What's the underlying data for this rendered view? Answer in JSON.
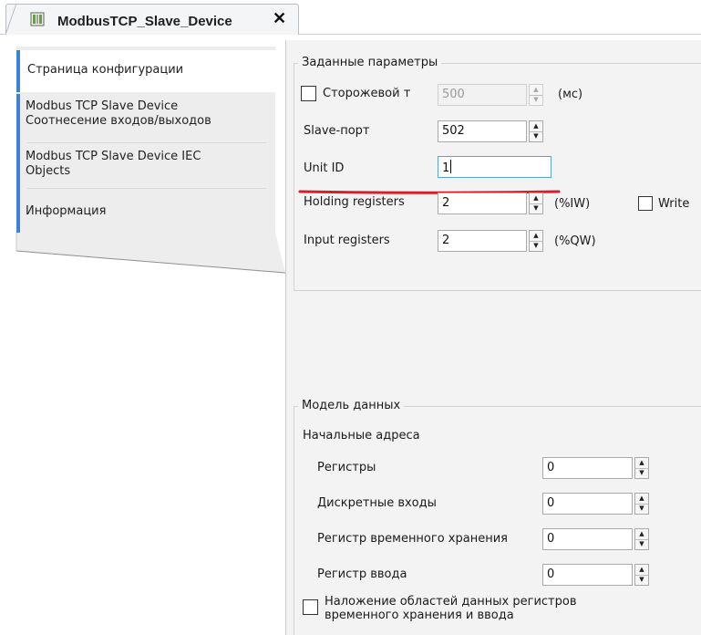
{
  "tab": {
    "title": "ModbusTCP_Slave_Device",
    "close": "✕"
  },
  "nav": {
    "items": [
      {
        "line1": "Страница конфигурации",
        "line2": ""
      },
      {
        "line1": "Modbus TCP Slave Device",
        "line2": "Соотнесение входов/выходов"
      },
      {
        "line1": "Modbus TCP Slave Device IEC",
        "line2": "Objects"
      },
      {
        "line1": "Информация",
        "line2": ""
      }
    ]
  },
  "params": {
    "title": "Заданные параметры",
    "watchdog": {
      "label": "Сторожевой т",
      "value": "500",
      "unit": "(мс)"
    },
    "slave_port": {
      "label": "Slave-порт",
      "value": "502"
    },
    "unit_id": {
      "label": "Unit ID",
      "value": "1"
    },
    "holding": {
      "label": "Holding registers",
      "value": "2",
      "unit": "(%IW)",
      "write_label": "Write"
    },
    "input": {
      "label": "Input registers",
      "value": "2",
      "unit": "(%QW)"
    }
  },
  "model": {
    "title": "Модель данных",
    "start_addresses": "Начальные адреса",
    "registers": {
      "label": "Регистры",
      "value": "0"
    },
    "discrete_inputs": {
      "label": "Дискретные входы",
      "value": "0"
    },
    "holding_storage": {
      "label": "Регистр временного хранения",
      "value": "0"
    },
    "input_register": {
      "label": "Регистр ввода",
      "value": "0"
    },
    "overlay": {
      "line1": "Наложение областей данных регистров",
      "line2": "временного хранения и ввода"
    }
  },
  "colors": {
    "accent": "#3c82d8",
    "highlight_underline": "#d4202a"
  }
}
